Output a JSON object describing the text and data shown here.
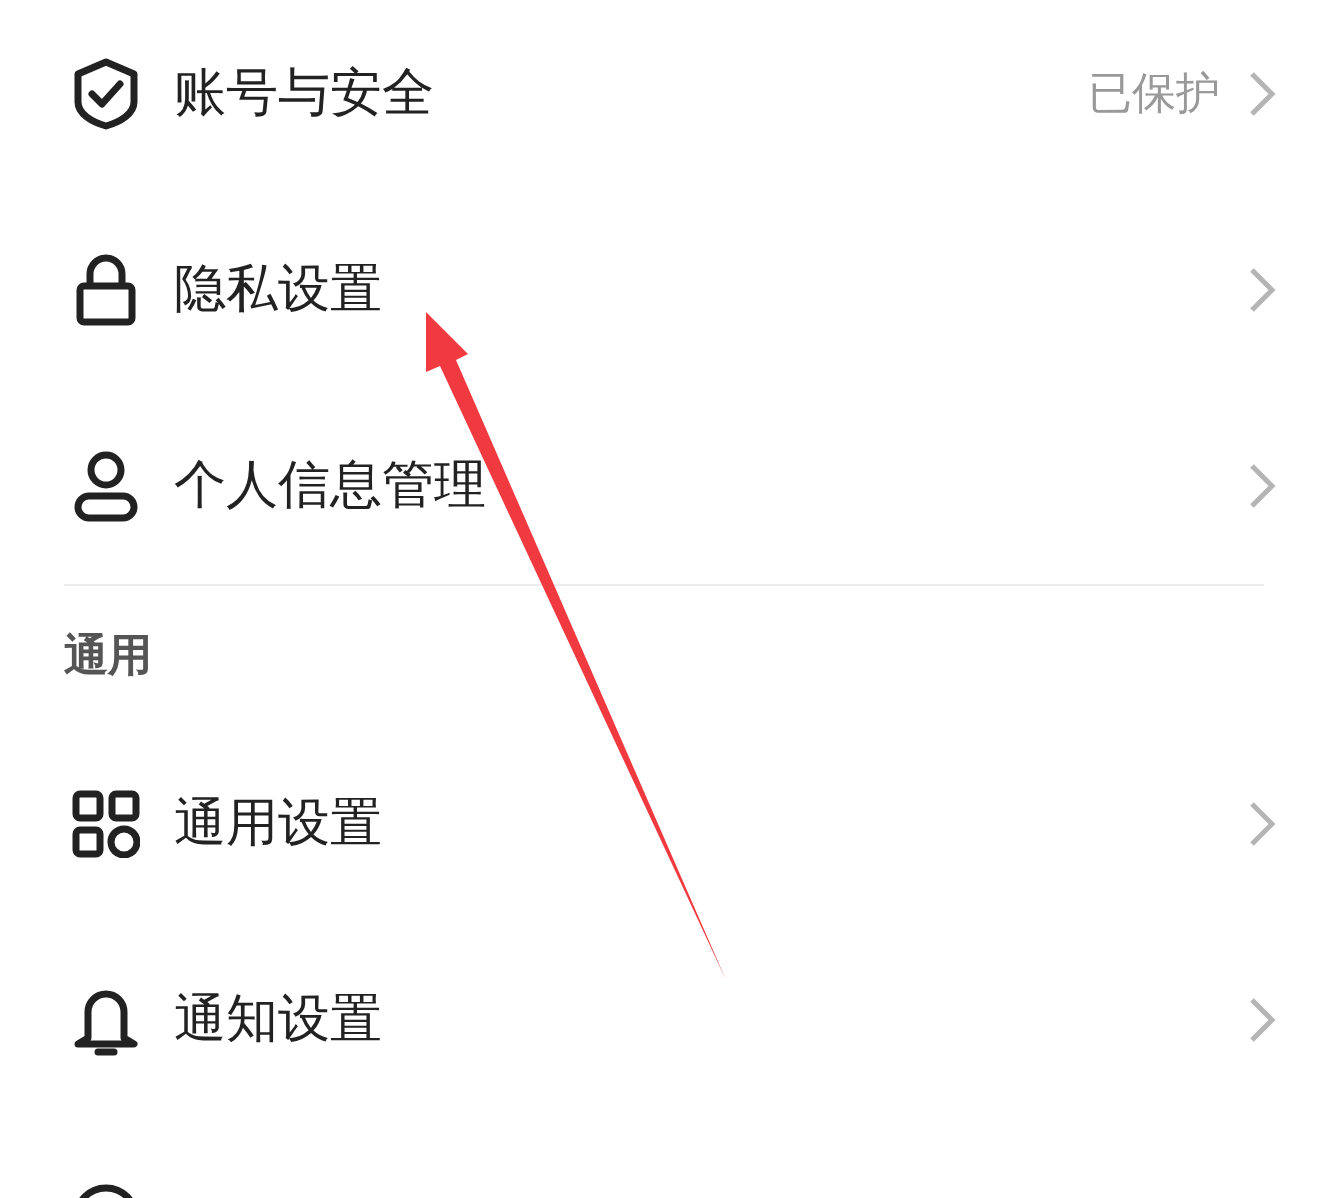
{
  "sections": [
    {
      "items": [
        {
          "label": "账号与安全",
          "value": "已保护"
        },
        {
          "label": "隐私设置"
        },
        {
          "label": "个人信息管理"
        }
      ]
    },
    {
      "title": "通用",
      "items": [
        {
          "label": "通用设置"
        },
        {
          "label": "通知设置"
        }
      ]
    }
  ]
}
